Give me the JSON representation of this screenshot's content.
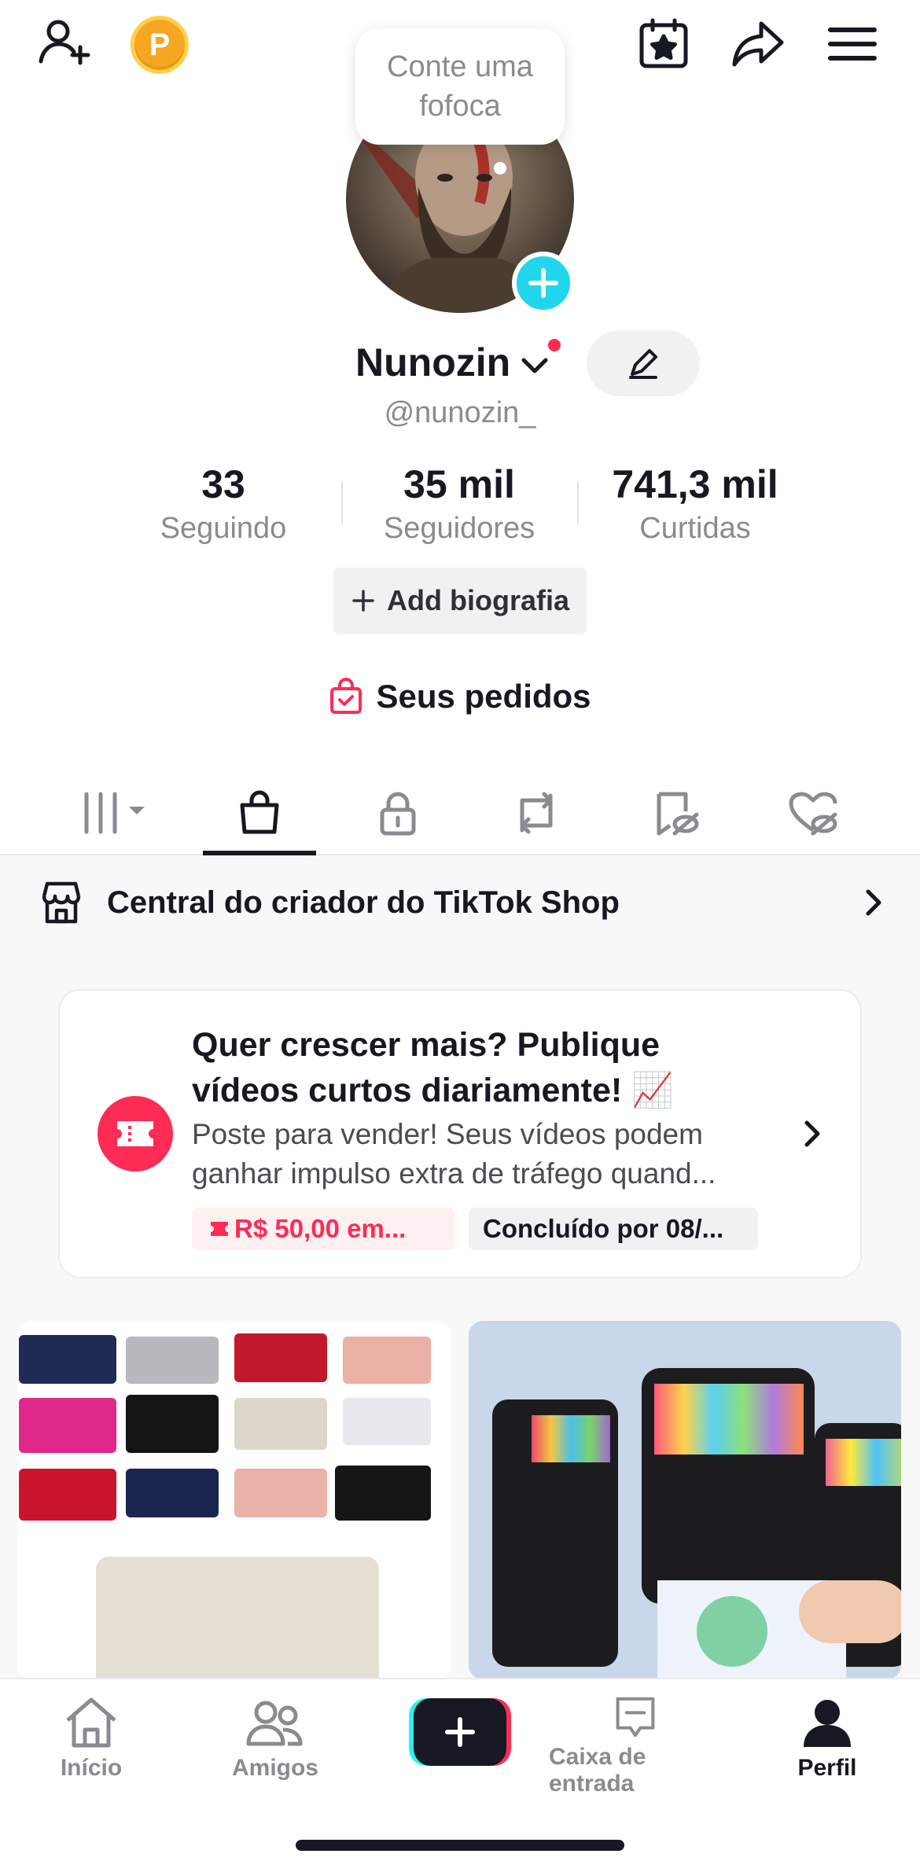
{
  "bubble": {
    "text": "Conte uma fofoca"
  },
  "profile": {
    "name": "Nunozin",
    "handle": "@nunozin_",
    "stats": [
      {
        "value": "33",
        "label": "Seguindo"
      },
      {
        "value": "35 mil",
        "label": "Seguidores"
      },
      {
        "value": "741,3 mil",
        "label": "Curtidas"
      }
    ],
    "add_bio_label": "Add biografia",
    "orders_label": "Seus pedidos"
  },
  "tabs": [
    "videos-grid",
    "shop",
    "private",
    "reposts",
    "favorites",
    "liked"
  ],
  "shop_center": {
    "label": "Central do criador do TikTok Shop"
  },
  "promo_card": {
    "title": "Quer crescer mais? Publique vídeos curtos diariamente! 📈",
    "body": "Poste para vender! Seus vídeos podem ganhar impulso extra de tráfego quand...",
    "reward_tag": "R$ 50,00 em...",
    "deadline_tag": "Concluído por 08/..."
  },
  "bottom_nav": {
    "items": [
      {
        "label": "Início"
      },
      {
        "label": "Amigos"
      },
      {
        "label": ""
      },
      {
        "label": "Caixa de entrada"
      },
      {
        "label": "Perfil"
      }
    ]
  },
  "colors": {
    "accent_red": "#fe2c55",
    "accent_cyan": "#20d5ec",
    "text_primary": "#161823",
    "text_secondary": "#8a8b91"
  }
}
